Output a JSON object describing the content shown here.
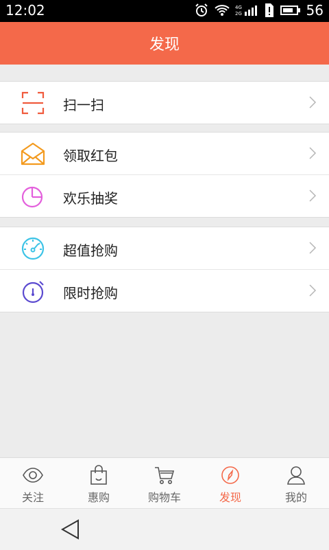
{
  "status": {
    "time": "12:02",
    "battery_level": "56"
  },
  "header": {
    "title": "发现"
  },
  "groups": [
    {
      "items": [
        {
          "label": "扫一扫",
          "icon": "scan-icon"
        }
      ]
    },
    {
      "items": [
        {
          "label": "领取红包",
          "icon": "envelope-icon"
        },
        {
          "label": "欢乐抽奖",
          "icon": "pie-chart-icon"
        }
      ]
    },
    {
      "items": [
        {
          "label": "超值抢购",
          "icon": "gauge-icon"
        },
        {
          "label": "限时抢购",
          "icon": "stopwatch-icon"
        }
      ]
    }
  ],
  "tabs": [
    {
      "label": "关注",
      "icon": "eye-icon"
    },
    {
      "label": "惠购",
      "icon": "shopping-bag-icon"
    },
    {
      "label": "购物车",
      "icon": "cart-icon"
    },
    {
      "label": "发现",
      "icon": "compass-icon",
      "active": true
    },
    {
      "label": "我的",
      "icon": "user-icon"
    }
  ],
  "colors": {
    "accent": "#f4694a",
    "scan": "#f05a3c",
    "envelope": "#f39a1e",
    "pie": "#e35fdc",
    "gauge": "#3cc3e6",
    "stopwatch": "#5b4ad0"
  }
}
